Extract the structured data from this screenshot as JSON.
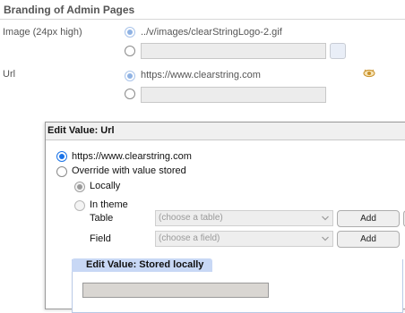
{
  "section": {
    "title": "Branding of Admin Pages"
  },
  "image_row": {
    "label": "Image (24px high)",
    "default_value": "../v/images/clearStringLogo-2.gif",
    "custom_value": ""
  },
  "url_row": {
    "label": "Url",
    "default_value": "https://www.clearstring.com",
    "custom_value": ""
  },
  "dialog": {
    "title": "Edit Value: Url",
    "option_default": "https://www.clearstring.com",
    "option_override": "Override with value stored",
    "option_locally": "Locally",
    "option_in_theme": "In theme",
    "table_label": "Table",
    "table_placeholder": "(choose a table)",
    "field_label": "Field",
    "field_placeholder": "(choose a field)",
    "add_label": "Add",
    "inner_panel_title": "Edit Value: Stored locally",
    "inner_value": ""
  },
  "icons": [
    "eye-icon",
    "chevron-down-icon"
  ],
  "colors": {
    "accent": "#1a73e8",
    "tab_blue": "#c8d8f5"
  }
}
